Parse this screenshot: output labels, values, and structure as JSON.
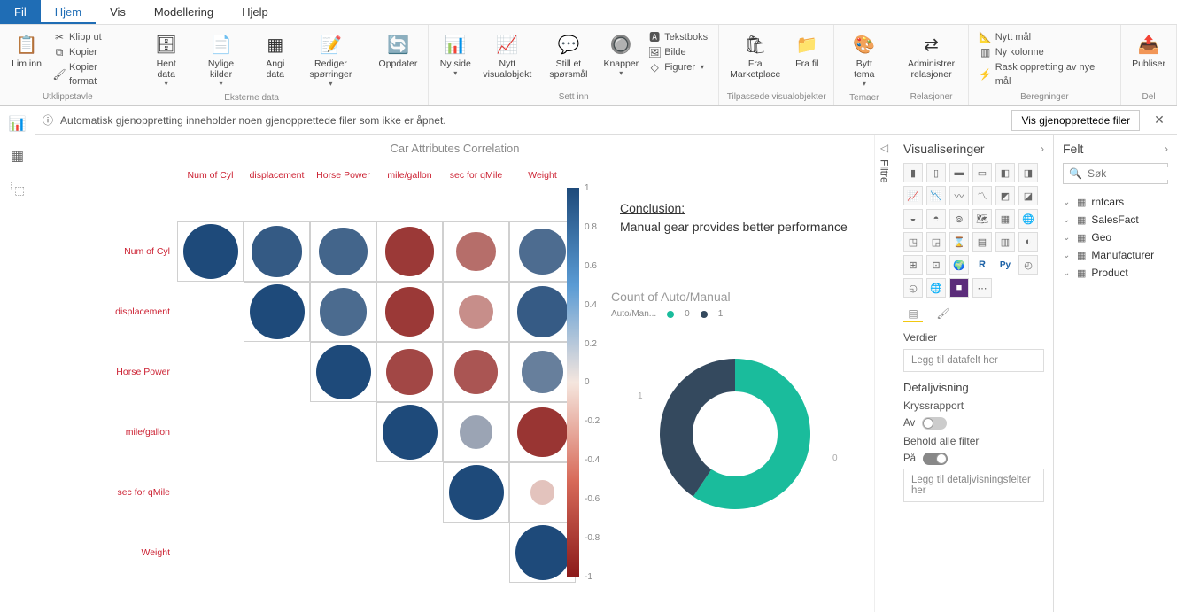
{
  "tabs": {
    "fil": "Fil",
    "hjem": "Hjem",
    "vis": "Vis",
    "modellering": "Modellering",
    "hjelp": "Hjelp"
  },
  "clipboard": {
    "paste": "Lim inn",
    "cut": "Klipp ut",
    "copy": "Kopier",
    "format": "Kopier format",
    "group": "Utklippstavle"
  },
  "extern": {
    "hent": "Hent data",
    "nylige": "Nylige kilder",
    "angi": "Angi data",
    "rediger": "Rediger spørringer",
    "group": "Eksterne data"
  },
  "oppd": {
    "label": "Oppdater"
  },
  "settinn": {
    "ny": "Ny side",
    "nytt": "Nytt visualobjekt",
    "spors": "Still et spørsmål",
    "knapper": "Knapper",
    "tekst": "Tekstboks",
    "bilde": "Bilde",
    "figurer": "Figurer",
    "group": "Sett inn"
  },
  "tilpassede": {
    "market": "Fra Marketplace",
    "frafil": "Fra fil",
    "group": "Tilpassede visualobjekter"
  },
  "temaer": {
    "bytt": "Bytt tema",
    "group": "Temaer"
  },
  "relasjoner": {
    "admin": "Administrer relasjoner",
    "group": "Relasjoner"
  },
  "beregninger": {
    "mal": "Nytt mål",
    "kolonne": "Ny kolonne",
    "rask": "Rask oppretting av nye mål",
    "group": "Beregninger"
  },
  "del": {
    "publiser": "Publiser",
    "group": "Del"
  },
  "infobar": {
    "msg": "Automatisk gjenoppretting inneholder noen gjenopprettede filer som ikke er åpnet.",
    "btn": "Vis gjenopprettede filer"
  },
  "filters_label": "Filtre",
  "viz_panel": {
    "title": "Visualiseringer",
    "verdier": "Verdier",
    "addfield": "Legg til datafelt her",
    "detail": "Detaljvisning",
    "kryss": "Kryssrapport",
    "av": "Av",
    "behold": "Behold alle filter",
    "pa": "På",
    "adddetail": "Legg til detaljvisningsfelter her"
  },
  "fields_panel": {
    "title": "Felt",
    "search": "Søk",
    "tables": [
      "rntcars",
      "SalesFact",
      "Geo",
      "Manufacturer",
      "Product"
    ]
  },
  "chart_data": [
    {
      "type": "heatmap",
      "title": "Car Attributes Correlation",
      "categories": [
        "Num of Cyl",
        "displacement",
        "Horse Power",
        "mile/gallon",
        "sec for qMile",
        "Weight"
      ],
      "matrix": [
        [
          1.0,
          0.9,
          0.83,
          -0.85,
          -0.59,
          0.78
        ],
        [
          null,
          1.0,
          0.79,
          -0.85,
          -0.43,
          0.89
        ],
        [
          null,
          null,
          1.0,
          -0.78,
          -0.71,
          0.66
        ],
        [
          null,
          null,
          null,
          1.0,
          0.42,
          -0.87
        ],
        [
          null,
          null,
          null,
          null,
          1.0,
          -0.17
        ],
        [
          null,
          null,
          null,
          null,
          null,
          1.0
        ]
      ],
      "scale": {
        "min": -1,
        "max": 1
      },
      "ticks": [
        "1",
        "0.8",
        "0.6",
        "0.4",
        "0.2",
        "0",
        "-0.2",
        "-0.4",
        "-0.6",
        "-0.8",
        "-1"
      ]
    },
    {
      "type": "pie",
      "title": "Count of Auto/Manual",
      "legend_label": "Auto/Man...",
      "series": [
        {
          "name": "0",
          "value": 19,
          "color": "#1abc9c"
        },
        {
          "name": "1",
          "value": 13,
          "color": "#34495e"
        }
      ],
      "conclusion_title": "Conclusion:",
      "conclusion_text": "Manual gear provides better performance"
    }
  ]
}
